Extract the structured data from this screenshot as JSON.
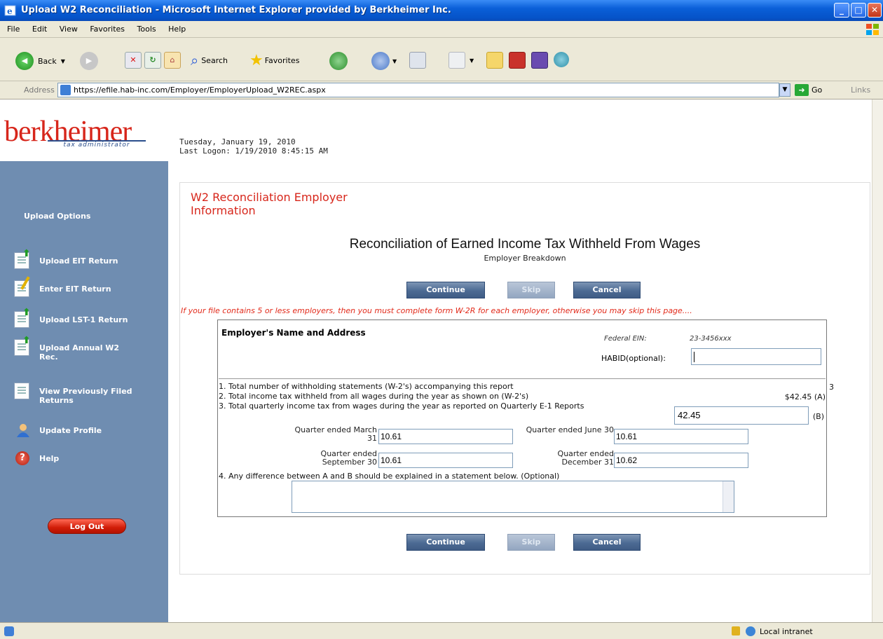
{
  "window": {
    "title": "Upload W2 Reconciliation - Microsoft Internet Explorer provided by Berkheimer Inc.",
    "min_label": "_",
    "max_label": "□",
    "close_label": "✕"
  },
  "menu": [
    "File",
    "Edit",
    "View",
    "Favorites",
    "Tools",
    "Help"
  ],
  "toolbar": {
    "back": "Back",
    "search": "Search",
    "favorites": "Favorites"
  },
  "address": {
    "label": "Address",
    "url": "https://efile.hab-inc.com/Employer/EmployerUpload_W2REC.aspx",
    "go": "Go",
    "links": "Links"
  },
  "header": {
    "logo": "berkheimer",
    "logo_tag": "tax administrator",
    "date": "Tuesday, January 19, 2010",
    "last_logon": "Last Logon: 1/19/2010 8:45:15 AM"
  },
  "sidebar": {
    "title": "Upload Options",
    "items": [
      {
        "label": "Upload EIT Return"
      },
      {
        "label": "Enter EIT Return"
      },
      {
        "label": "Upload LST-1 Return"
      },
      {
        "label": "Upload Annual W2 Rec."
      },
      {
        "label": "View Previously Filed Returns"
      },
      {
        "label": "Update Profile"
      },
      {
        "label": "Help"
      }
    ],
    "logout": "Log Out"
  },
  "main": {
    "section_title": "W2 Reconciliation Employer Information",
    "title": "Reconciliation of Earned Income Tax Withheld From Wages",
    "subtitle": "Employer Breakdown",
    "buttons": {
      "continue": "Continue",
      "skip": "Skip",
      "cancel": "Cancel"
    },
    "warning": "If your file contains 5 or less employers, then you must complete form W-2R for each employer, otherwise you may skip this page....",
    "employer_header": "Employer's Name and Address",
    "ein_label": "Federal EIN:",
    "ein_value": "23-3456xxx",
    "habid_label": "HABID(optional):",
    "habid_value": "",
    "line1": "1. Total number of withholding statements (W-2's) accompanying this report",
    "line1_value": "3",
    "line2": "2. Total income tax withheld from all wages during the year as shown on (W-2's)",
    "line2_value": "$42.45 (A)",
    "line3": "3. Total quarterly income tax from wages during the year as reported on Quarterly E-1 Reports",
    "line3_value": "42.45",
    "line3_suffix": "(B)",
    "quarters": [
      {
        "label": "Quarter ended March 31",
        "value": "10.61"
      },
      {
        "label": "Quarter ended June 30",
        "value": "10.61"
      },
      {
        "label": "Quarter ended September 30",
        "value": "10.61"
      },
      {
        "label": "Quarter ended December 31",
        "value": "10.62"
      }
    ],
    "line4": "4. Any difference between A and B should be explained in a statement below. (Optional)",
    "explanation": ""
  },
  "status": {
    "zone": "Local intranet"
  },
  "colors": {
    "brand_red": "#d7261b",
    "sidebar_blue": "#6f8db1",
    "button_blue": "#4c6a93"
  }
}
